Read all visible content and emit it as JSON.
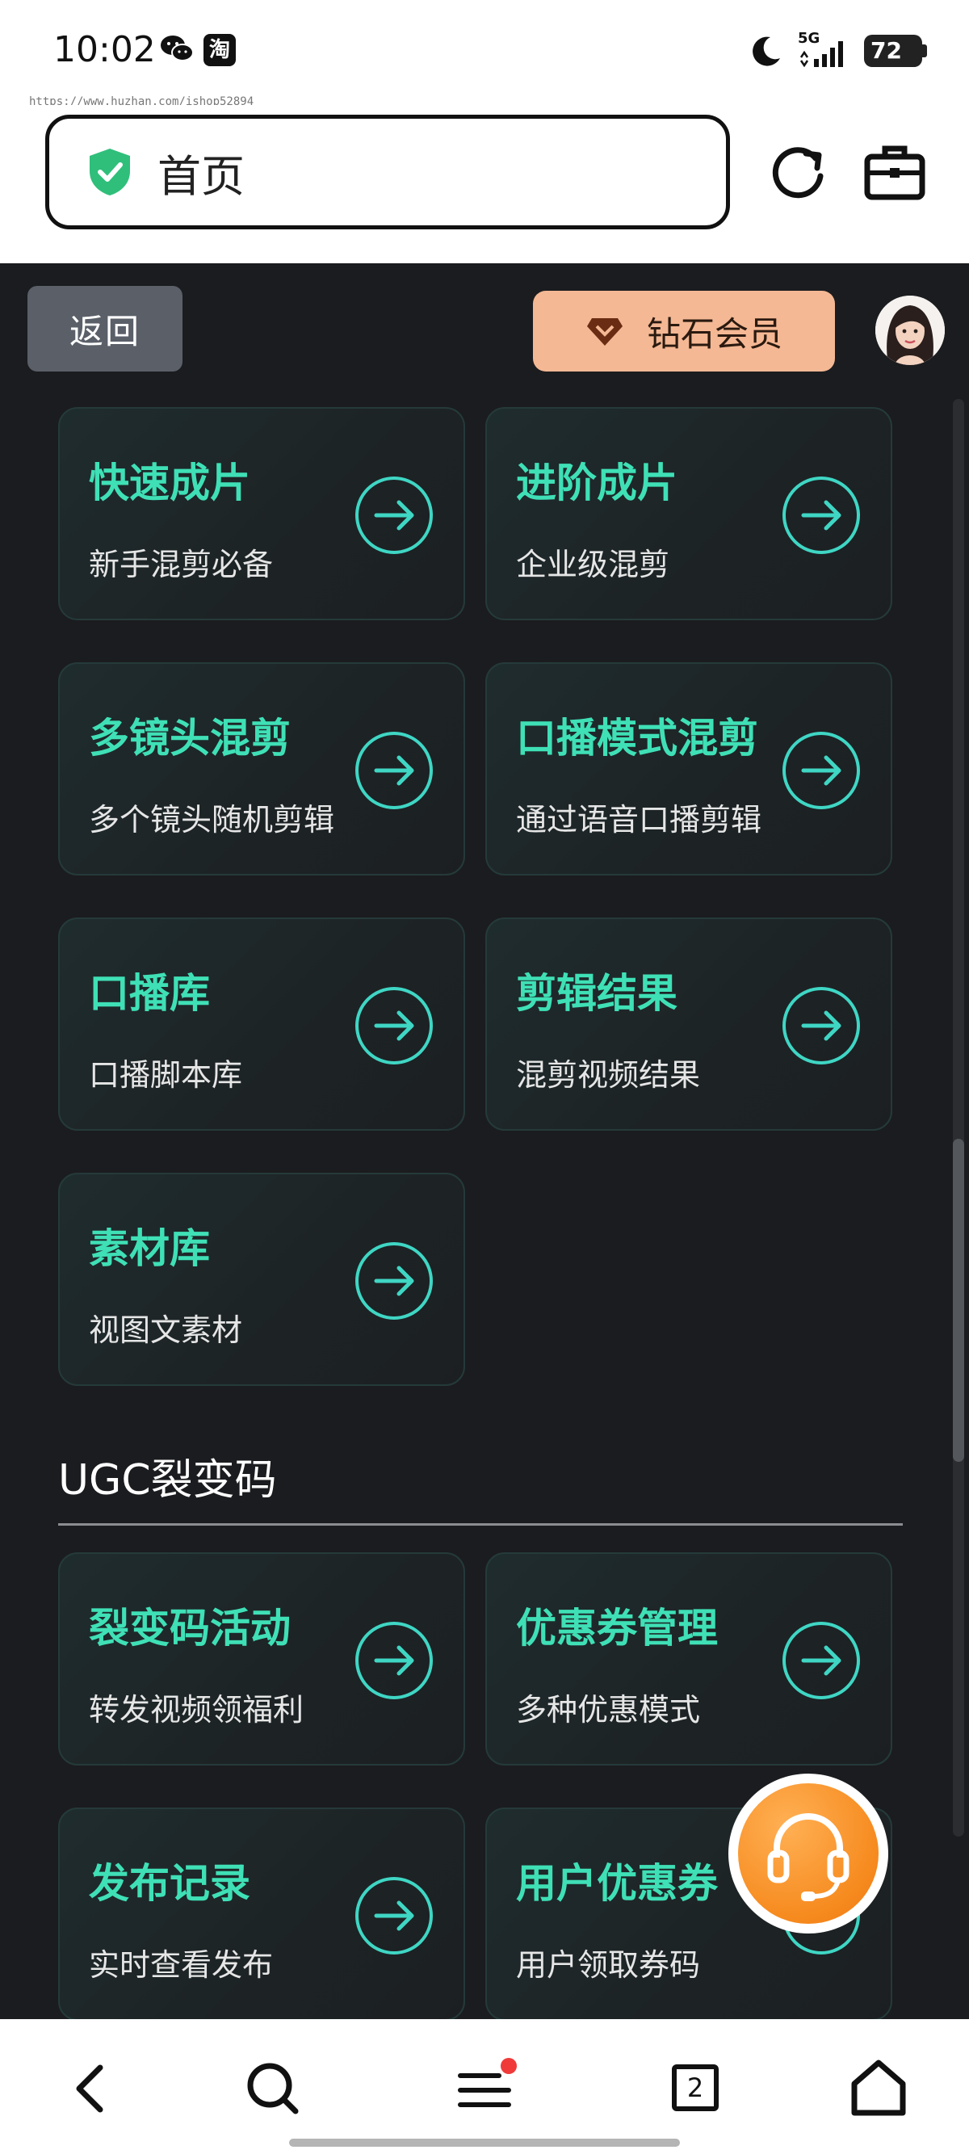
{
  "status_bar": {
    "time": "10:02",
    "taobao_glyph": "淘",
    "network": "5G",
    "battery": "72",
    "icons": [
      "wechat-icon",
      "taobao-icon",
      "moon-icon",
      "signal-icon",
      "battery-icon"
    ]
  },
  "url_hint": "https://www.huzhan.com/ishop52894",
  "address_bar": {
    "title": "首页",
    "icons": [
      "shield-check-icon",
      "reload-icon",
      "briefcase-icon"
    ]
  },
  "header": {
    "back_label": "返回",
    "vip_label": "钻石会员",
    "vip_icon": "diamond-icon"
  },
  "cards": [
    {
      "title": "快速成片",
      "subtitle": "新手混剪必备"
    },
    {
      "title": "进阶成片",
      "subtitle": "企业级混剪"
    },
    {
      "title": "多镜头混剪",
      "subtitle": "多个镜头随机剪辑"
    },
    {
      "title": "口播模式混剪",
      "subtitle": "通过语音口播剪辑"
    },
    {
      "title": "口播库",
      "subtitle": "口播脚本库"
    },
    {
      "title": "剪辑结果",
      "subtitle": "混剪视频结果"
    },
    {
      "title": "素材库",
      "subtitle": "视图文素材"
    }
  ],
  "ugc_section": {
    "title": "UGC裂变码",
    "cards": [
      {
        "title": "裂变码活动",
        "subtitle": "转发视频领福利"
      },
      {
        "title": "优惠券管理",
        "subtitle": "多种优惠模式"
      },
      {
        "title": "发布记录",
        "subtitle": "实时查看发布"
      },
      {
        "title": "用户优惠券",
        "subtitle": "用户领取券码"
      }
    ]
  },
  "bottom_nav": {
    "tab_count": "2",
    "icons": [
      "back-icon",
      "search-icon",
      "menu-icon",
      "tabs-icon",
      "home-icon"
    ]
  },
  "colors": {
    "accent": "#3fe0b6",
    "page_bg": "#1b1c1f",
    "vip_bg": "#f4b894",
    "support_orange": "#f68a1e",
    "notification_dot": "#f03a3a"
  }
}
